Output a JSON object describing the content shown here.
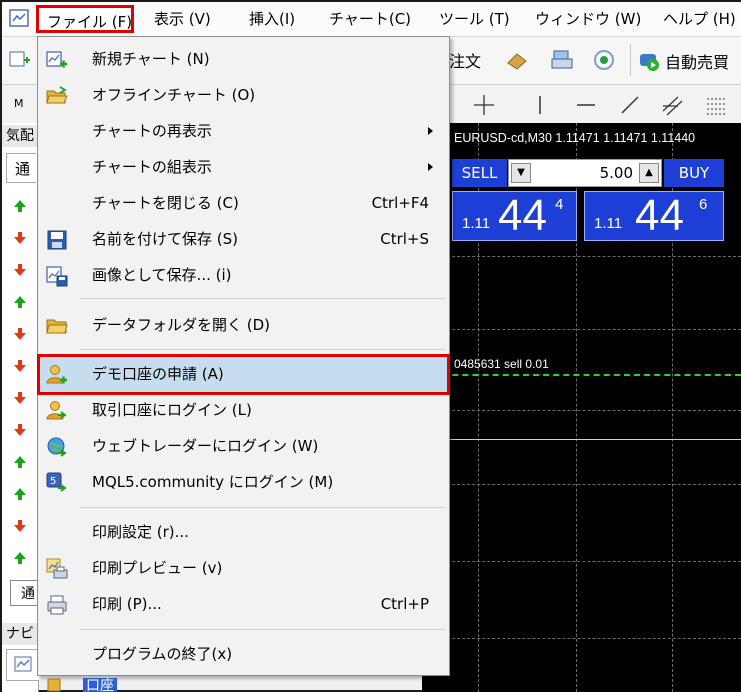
{
  "menubar": {
    "items": [
      "ファイル (F)",
      "表示 (V)",
      "挿入(I)",
      "チャート(C)",
      "ツール (T)",
      "ウィンドウ (W)",
      "ヘルプ (H)"
    ]
  },
  "toolbar": {
    "order_label": "注文",
    "auto_trade_label": "自動売買",
    "m_label": "M"
  },
  "left_panel": {
    "title_top": "気配",
    "tab_top": "通",
    "title_bottom": "ナビ",
    "tab_bottom": "通",
    "navigator_item": "口座"
  },
  "chart": {
    "title": "EURUSD-cd,M30  1.11471 1.11471 1.11440",
    "sell_label": "SELL",
    "buy_label": "BUY",
    "lot_value": "5.00",
    "sell_price_small": "1.11",
    "sell_price_big": "44",
    "sell_price_sup": "4",
    "buy_price_small": "1.11",
    "buy_price_big": "44",
    "buy_price_sup": "6",
    "order_label": "0485631 sell 0.01"
  },
  "file_menu": {
    "items": [
      {
        "label": "新規チャート (N)",
        "icon": "new-chart-icon"
      },
      {
        "label": "オフラインチャート (O)",
        "icon": "folder-icon"
      },
      {
        "label": "チャートの再表示",
        "submenu": true
      },
      {
        "label": "チャートの組表示",
        "submenu": true
      },
      {
        "label": "チャートを閉じる (C)",
        "shortcut": "Ctrl+F4"
      },
      {
        "label": "名前を付けて保存 (S)",
        "shortcut": "Ctrl+S",
        "icon": "save-icon"
      },
      {
        "label": "画像として保存... (i)",
        "icon": "save-image-icon"
      },
      {
        "label": "データフォルダを開く (D)",
        "icon": "folder-icon"
      },
      {
        "label": "デモ口座の申請 (A)",
        "icon": "add-account-icon",
        "highlighted": true
      },
      {
        "label": "取引口座にログイン (L)",
        "icon": "login-account-icon"
      },
      {
        "label": "ウェブトレーダーにログイン (W)",
        "icon": "webtrader-icon"
      },
      {
        "label": "MQL5.community にログイン (M)",
        "icon": "mql5-icon"
      },
      {
        "label": "印刷設定 (r)..."
      },
      {
        "label": "印刷プレビュー (v)",
        "icon": "print-preview-icon"
      },
      {
        "label": "印刷 (P)...",
        "shortcut": "Ctrl+P",
        "icon": "printer-icon"
      },
      {
        "label": "プログラムの終了(x)"
      }
    ]
  },
  "colors": {
    "highlight_border": "#e00000",
    "hover_bg": "#c6dcef",
    "chart_bg": "#000000",
    "trade_blue": "#1e3fd6"
  }
}
